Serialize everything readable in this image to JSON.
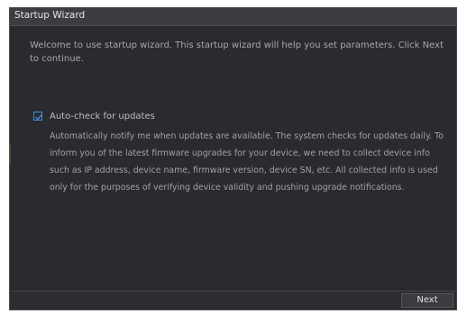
{
  "window": {
    "title": "Startup Wizard"
  },
  "main": {
    "welcome_text": "Welcome to use startup wizard. This startup wizard will help you set parameters. Click Next to continue.",
    "auto_check": {
      "label": "Auto-check for updates",
      "checked": true,
      "description": "Automatically notify me when updates are available. The system checks for updates daily. To inform you of the latest firmware upgrades for your device, we need to collect device info such as IP address, device name, firmware version, device SN, etc. All collected info is used only for the purposes of verifying device validity and pushing upgrade notifications."
    }
  },
  "footer": {
    "next_label": "Next"
  },
  "colors": {
    "dialog_bg": "#2a2b2e",
    "titlebar_bg": "#3c3d41",
    "accent": "#3f8fe0"
  },
  "icons": {
    "checkbox": "checkmark-icon"
  }
}
